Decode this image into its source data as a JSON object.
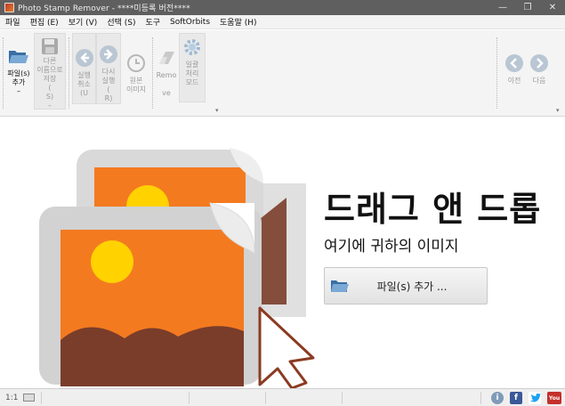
{
  "window": {
    "title": "Photo Stamp Remover - ****미등록 버전****",
    "minimize": "—",
    "maximize": "❐",
    "close": "✕"
  },
  "menu": [
    {
      "label": "파일"
    },
    {
      "label": "편집 (E)"
    },
    {
      "label": "보기 (V)"
    },
    {
      "label": "선택 (S)"
    },
    {
      "label": "도구"
    },
    {
      "label": "SoftOrbits"
    },
    {
      "label": "도움말 (H)"
    }
  ],
  "toolbar": {
    "add_file": "파일(s)\n추가\n–",
    "save_as": "다른\n이름으로\n저장\n(\nS)\n–",
    "undo": "실행\n취소\n(U",
    "redo": "다시\n실행\n(\nR)",
    "original": "원본\n이미지",
    "remove": "Remo\n\nve",
    "batch": "일괄\n처리\n모드",
    "prev": "이전",
    "next": "다음",
    "overflow": "▾"
  },
  "main": {
    "headline": "드래그 앤 드롭",
    "subline": "여기에 귀하의 이미지",
    "add_button": "파일(s) 추가 ..."
  },
  "status": {
    "zoom": "1:1",
    "info_icon": "info-icon",
    "facebook": "f",
    "twitter": "twitter-icon",
    "youtube": "You"
  },
  "colors": {
    "accent_orange": "#f47a20",
    "sun_yellow": "#ffd200",
    "mountain_brown": "#7a3d2a",
    "frame_gray": "#d9d9d9",
    "icon_blue": "#7aa9d6"
  }
}
